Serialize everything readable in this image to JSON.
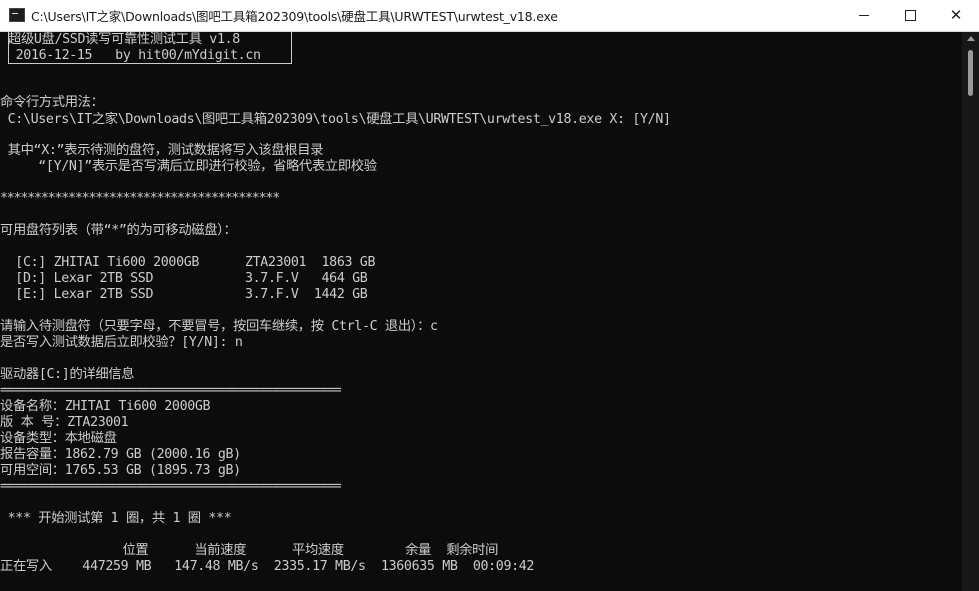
{
  "window": {
    "title": "C:\\Users\\IT之家\\Downloads\\图吧工具箱202309\\tools\\硬盘工具\\URWTEST\\urwtest_v18.exe"
  },
  "console": {
    "lines": [
      "超级U盘/SSD读写可靠性测试工具 v1.8",
      " 2016-12-15   by hit00/mYdigit.cn",
      "命令行方式用法：",
      " C:\\Users\\IT之家\\Downloads\\图吧工具箱202309\\tools\\硬盘工具\\URWTEST\\urwtest_v18.exe X: [Y/N]",
      " 其中“X:”表示待测的盘符，测试数据将写入该盘根目录",
      "     “[Y/N]”表示是否写满后立即进行校验，省略代表立即校验",
      "*****************************************",
      "可用盘符列表（带“*”的为可移动磁盘）：",
      "  [C:] ZHITAI Ti600 2000GB      ZTA23001  1863 GB",
      "  [D:] Lexar 2TB SSD            3.7.F.V   464 GB",
      "  [E:] Lexar 2TB SSD            3.7.F.V  1442 GB",
      "请输入待测盘符（只要字母，不要冒号，按回车继续，按 Ctrl-C 退出）：c",
      "是否写入测试数据后立即校验？[Y/N]: n",
      "驱动器[C:]的详细信息",
      "==================================================",
      "设备名称：ZHITAI Ti600 2000GB",
      "版 本 号：ZTA23001",
      "设备类型：本地磁盘",
      "报告容量：1862.79 GB (2000.16 gB)",
      "可用空间：1765.53 GB (1895.73 gB)",
      "==================================================",
      " *** 开始测试第 1 圈，共 1 圈 ***",
      "                位置      当前速度      平均速度        余量  剩余时间",
      "正在写入    447259 MB   147.48 MB/s  2335.17 MB/s  1360635 MB  00:09:42"
    ]
  },
  "icons": {
    "app": "console-app-icon",
    "minimize": "minimize-icon",
    "maximize": "maximize-icon",
    "close": "close-icon"
  },
  "colors": {
    "background": "#0c0c0c",
    "foreground": "#cccccc",
    "titlebar": "#ffffff"
  }
}
